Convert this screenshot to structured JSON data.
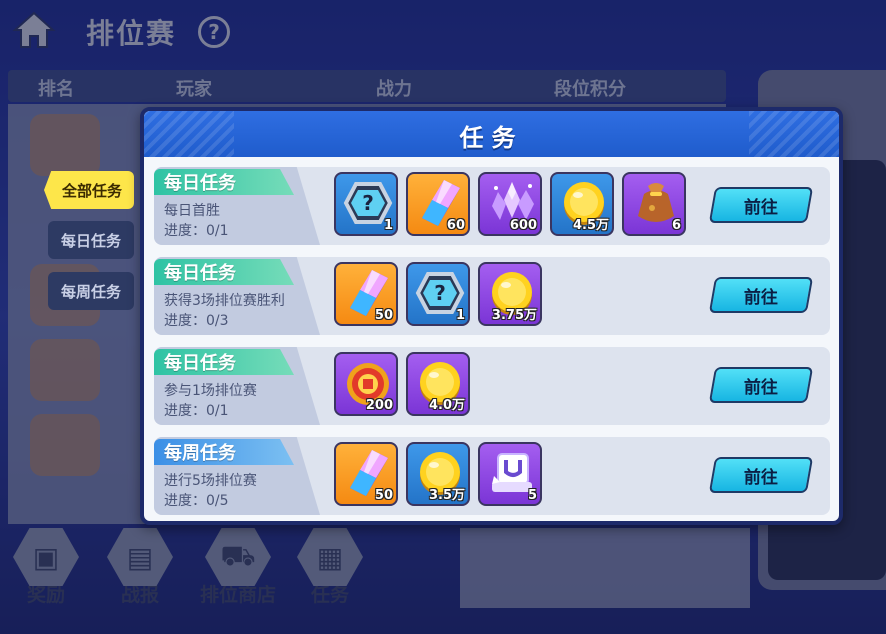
{
  "header": {
    "title": "排位赛",
    "help": "?"
  },
  "rank_table": {
    "columns": [
      "排名",
      "玩家",
      "战力",
      "段位积分"
    ]
  },
  "side_tabs": [
    {
      "label": "全部任务",
      "active": true
    },
    {
      "label": "每日任务",
      "active": false
    },
    {
      "label": "每周任务",
      "active": false
    }
  ],
  "bottom_nav": [
    {
      "label": "奖励",
      "icon": "gift-box-icon"
    },
    {
      "label": "战报",
      "icon": "report-icon"
    },
    {
      "label": "排位商店",
      "icon": "shopping-cart-icon"
    },
    {
      "label": "任务",
      "icon": "task-list-icon"
    }
  ],
  "modal": {
    "title": "任务",
    "tasks": [
      {
        "type": "每日任务",
        "kind": "daily",
        "name": "每日首胜",
        "progress": "进度：0/1",
        "button": "前往",
        "rewards": [
          {
            "icon": "mystery-chip-icon",
            "bg": "blue",
            "qty": "1"
          },
          {
            "icon": "crystal-icon",
            "bg": "orange",
            "qty": "60"
          },
          {
            "icon": "purple-crystal-cluster-icon",
            "bg": "purple",
            "qty": "600"
          },
          {
            "icon": "gold-coin-icon",
            "bg": "blue",
            "qty": "4.5万"
          },
          {
            "icon": "treasure-bag-icon",
            "bg": "purple",
            "qty": "6"
          }
        ]
      },
      {
        "type": "每日任务",
        "kind": "daily",
        "name": "获得3场排位赛胜利",
        "progress": "进度：0/3",
        "button": "前往",
        "rewards": [
          {
            "icon": "crystal-icon",
            "bg": "orange",
            "qty": "50"
          },
          {
            "icon": "mystery-chip-icon",
            "bg": "blue",
            "qty": "1"
          },
          {
            "icon": "gold-coin-icon",
            "bg": "purple",
            "qty": "3.75万"
          }
        ]
      },
      {
        "type": "每日任务",
        "kind": "daily",
        "name": "参与1场排位赛",
        "progress": "进度：0/1",
        "button": "前往",
        "rewards": [
          {
            "icon": "medal-token-icon",
            "bg": "purple",
            "qty": "200"
          },
          {
            "icon": "gold-coin-icon",
            "bg": "purple",
            "qty": "4.0万"
          }
        ]
      },
      {
        "type": "每周任务",
        "kind": "weekly",
        "name": "进行5场排位赛",
        "progress": "进度：0/5",
        "button": "前往",
        "rewards": [
          {
            "icon": "crystal-icon",
            "bg": "orange",
            "qty": "50"
          },
          {
            "icon": "gold-coin-icon",
            "bg": "blue",
            "qty": "3.5万"
          },
          {
            "icon": "magnet-cube-icon",
            "bg": "purple",
            "qty": "5"
          }
        ]
      }
    ]
  }
}
